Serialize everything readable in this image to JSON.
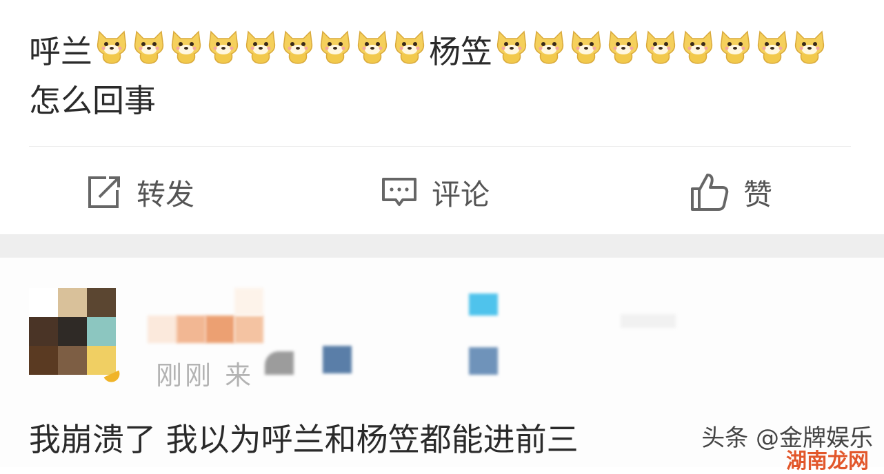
{
  "post": {
    "text_before": "呼兰",
    "text_middle": "杨笠",
    "text_line2": "怎么回事",
    "emoji_icon": "yellow-dog-emoji",
    "emoji_count_before": 9,
    "emoji_count_after": 9
  },
  "actions": {
    "repost_label": "转发",
    "comment_label": "评论",
    "like_label": "赞"
  },
  "comment": {
    "meta": "刚刚 来",
    "text": "我崩溃了 我以为呼兰和杨笠都能进前三"
  },
  "watermark": {
    "main": "头条 @金牌娱乐",
    "sub": "湖南龙网"
  },
  "colors": {
    "text": "#2a2a2a",
    "action_text": "#555555",
    "meta_text": "#b3b3b3",
    "band": "#eeeeee",
    "emoji": "#f2c94c"
  }
}
